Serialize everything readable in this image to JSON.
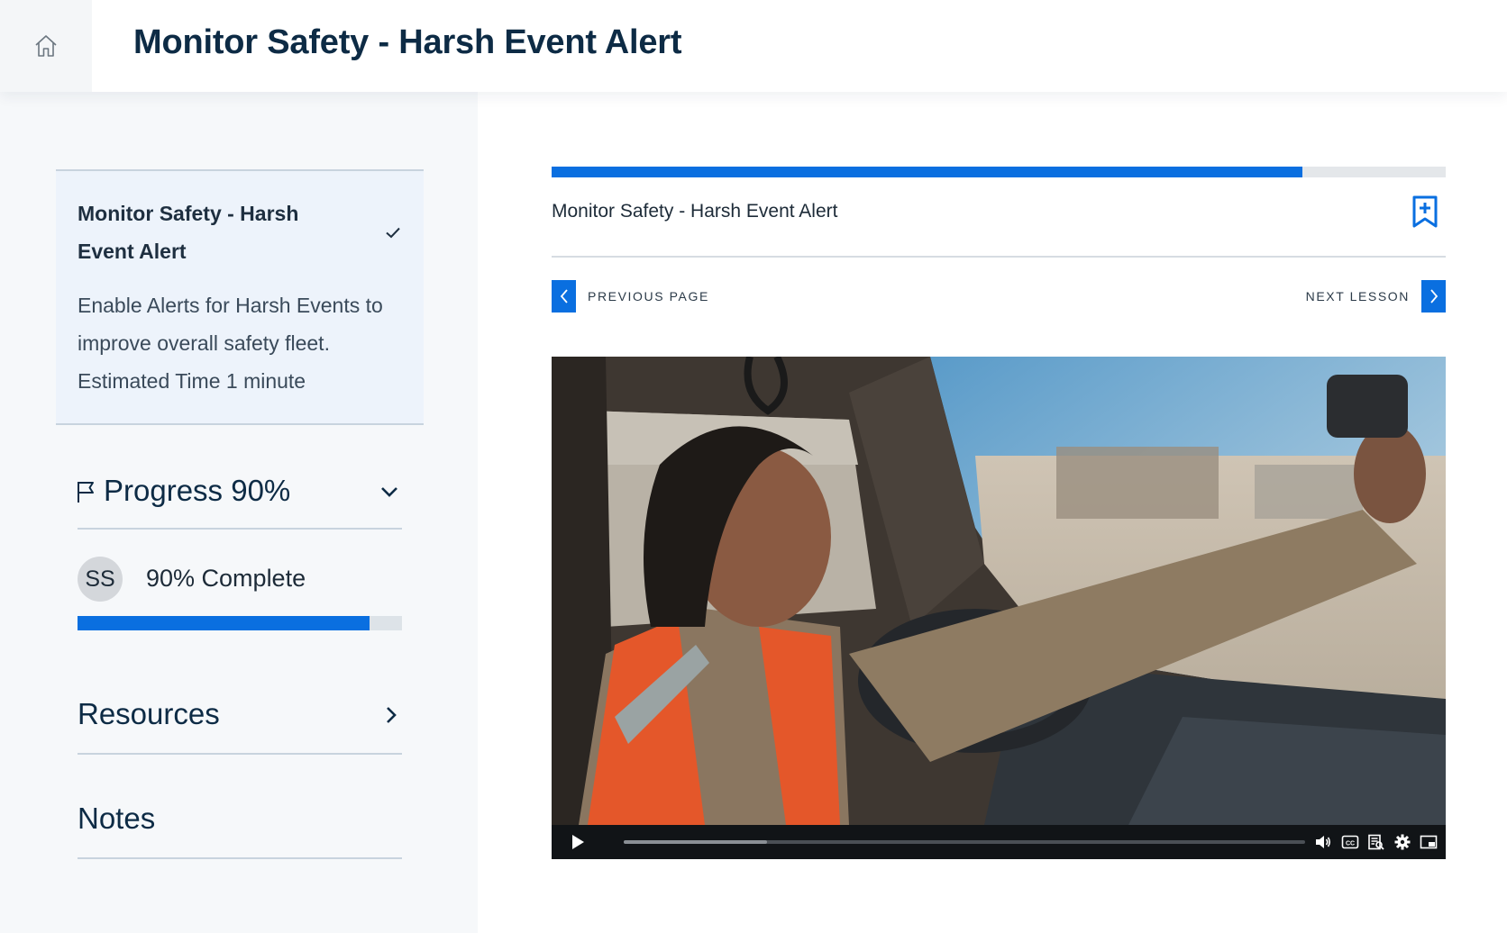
{
  "header": {
    "title": "Monitor Safety - Harsh Event Alert",
    "home_icon": "home-icon"
  },
  "sidebar": {
    "lesson_card": {
      "title": "Monitor Safety - Harsh Event Alert",
      "description_lines": [
        "Enable Alerts for Harsh Events to",
        "improve overall safety fleet.",
        "Estimated Time 1 minute"
      ],
      "status_icon": "check-icon"
    },
    "progress": {
      "title": "Progress 90%",
      "icon": "flag-icon",
      "avatar_initials": "SS",
      "complete_text": "90% Complete",
      "fraction": 0.9
    },
    "resources_label": "Resources",
    "notes_label": "Notes"
  },
  "main": {
    "lesson_progress_fraction": 0.84,
    "lesson_name": "Monitor Safety - Harsh Event Alert",
    "bookmark_icon": "bookmark-add-icon",
    "prev_label": "PREVIOUS PAGE",
    "next_label": "NEXT LESSON",
    "video": {
      "buffered_fraction": 0.21,
      "control_icons": [
        "play-icon",
        "volume-icon",
        "captions-icon",
        "transcript-icon",
        "settings-icon",
        "picture-in-picture-icon"
      ]
    }
  },
  "colors": {
    "accent": "#0a6fe0",
    "text_dark": "#0d2b45",
    "sidebar_bg": "#f6f8fa",
    "card_bg": "#edf3fb"
  }
}
